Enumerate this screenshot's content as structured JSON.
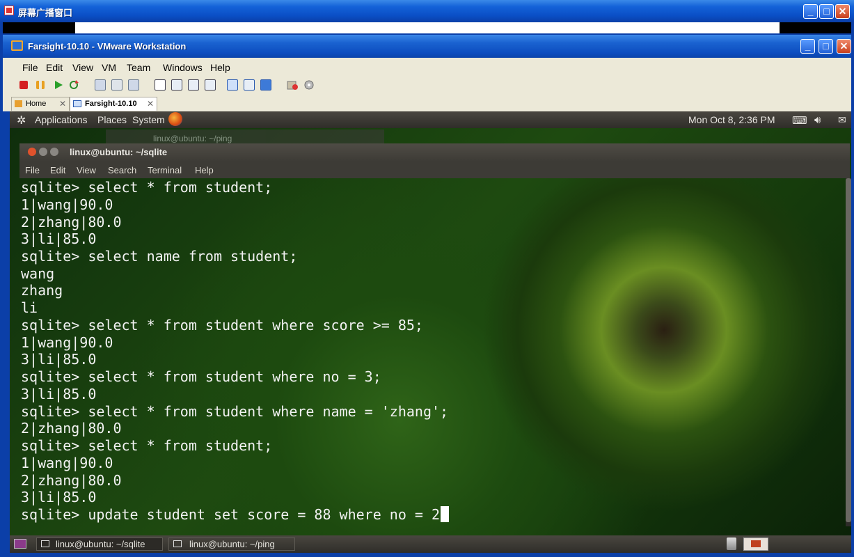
{
  "outer_window": {
    "title": "屏幕广播窗口"
  },
  "vmware": {
    "title": "Farsight-10.10 - VMware Workstation",
    "menu": [
      "File",
      "Edit",
      "View",
      "VM",
      "Team",
      "Windows",
      "Help"
    ],
    "tabs": [
      {
        "label": "Home",
        "active": false
      },
      {
        "label": "Farsight-10.10",
        "active": true
      }
    ]
  },
  "ubuntu_panel": {
    "menus": [
      "Applications",
      "Places",
      "System"
    ],
    "clock": "Mon Oct  8,  2:36 PM"
  },
  "background_window": {
    "title": "linux@ubuntu: ~/ping"
  },
  "terminal": {
    "title": "linux@ubuntu: ~/sqlite",
    "menu": [
      "File",
      "Edit",
      "View",
      "Search",
      "Terminal",
      "Help"
    ],
    "lines": [
      "sqlite> select * from student;",
      "1|wang|90.0",
      "2|zhang|80.0",
      "3|li|85.0",
      "sqlite> select name from student;",
      "wang",
      "zhang",
      "li",
      "sqlite> select * from student where score >= 85;",
      "1|wang|90.0",
      "3|li|85.0",
      "sqlite> select * from student where no = 3;",
      "3|li|85.0",
      "sqlite> select * from student where name = 'zhang';",
      "2|zhang|80.0",
      "sqlite> select * from student;",
      "1|wang|90.0",
      "2|zhang|80.0",
      "3|li|85.0",
      "sqlite> update student set score = 88 where no = 2"
    ]
  },
  "taskbar": {
    "items": [
      {
        "label": "linux@ubuntu: ~/sqlite"
      },
      {
        "label": "linux@ubuntu: ~/ping"
      }
    ]
  }
}
